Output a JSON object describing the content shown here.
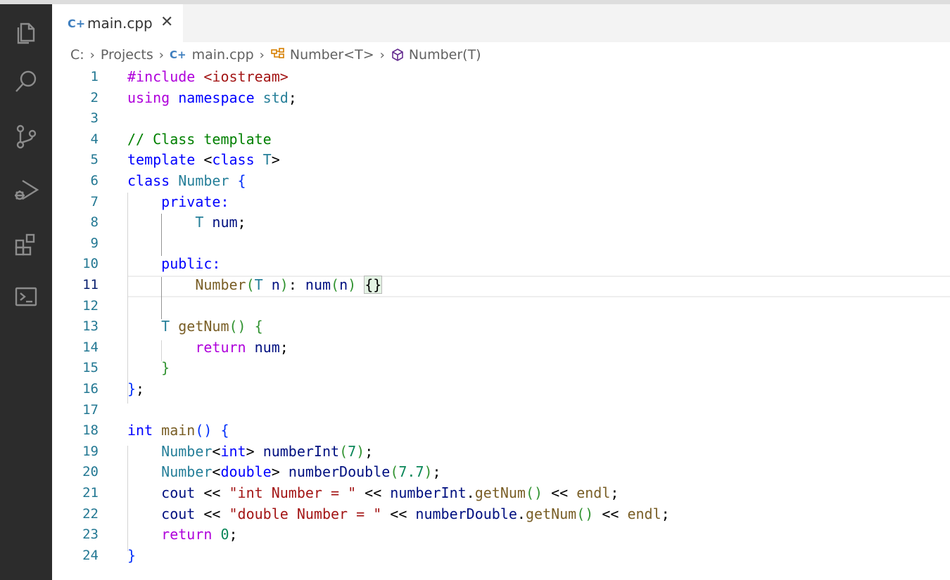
{
  "activity_bar": {
    "icons": [
      "explorer-icon",
      "search-icon",
      "source-control-icon",
      "run-debug-icon",
      "extensions-icon",
      "terminal-icon"
    ]
  },
  "tab": {
    "icon_text": "C+",
    "label": "main.cpp",
    "close": "✕"
  },
  "breadcrumb": {
    "drive": "C:",
    "folder": "Projects",
    "file_icon": "C+",
    "file": "main.cpp",
    "class": "Number<T>",
    "method": "Number(T)",
    "sep": "›"
  },
  "editor": {
    "active_line": 11,
    "line_numbers": [
      "1",
      "2",
      "3",
      "4",
      "5",
      "6",
      "7",
      "8",
      "9",
      "10",
      "11",
      "12",
      "13",
      "14",
      "15",
      "16",
      "17",
      "18",
      "19",
      "20",
      "21",
      "22",
      "23",
      "24"
    ],
    "lines": [
      [
        [
          "ctl",
          "#include "
        ],
        [
          "str",
          "<iostream>"
        ]
      ],
      [
        [
          "ctl",
          "using "
        ],
        [
          "kw",
          "namespace "
        ],
        [
          "ty",
          "std"
        ],
        [
          "",
          "; "
        ]
      ],
      [],
      [
        [
          "cm",
          "// Class template"
        ]
      ],
      [
        [
          "kw",
          "template "
        ],
        [
          "",
          "<"
        ],
        [
          "kw",
          "class "
        ],
        [
          "ty",
          "T"
        ],
        [
          "",
          ">"
        ]
      ],
      [
        [
          "kw",
          "class "
        ],
        [
          "ty",
          "Number "
        ],
        [
          "br",
          "{"
        ]
      ],
      [
        [
          "",
          "    "
        ],
        [
          "kw",
          "private:"
        ]
      ],
      [
        [
          "",
          "        "
        ],
        [
          "ty",
          "T "
        ],
        [
          "var",
          "num"
        ],
        [
          "",
          ";"
        ]
      ],
      [],
      [
        [
          "",
          "    "
        ],
        [
          "kw",
          "public:"
        ]
      ],
      [
        [
          "",
          "        "
        ],
        [
          "fn",
          "Number"
        ],
        [
          "br2",
          "("
        ],
        [
          "ty",
          "T "
        ],
        [
          "var",
          "n"
        ],
        [
          "br2",
          ")"
        ],
        [
          "",
          ": "
        ],
        [
          "var",
          "num"
        ],
        [
          "br2",
          "("
        ],
        [
          "var",
          "n"
        ],
        [
          "br2",
          ") "
        ],
        [
          "bm",
          "{}"
        ]
      ],
      [],
      [
        [
          "",
          "    "
        ],
        [
          "ty",
          "T "
        ],
        [
          "fn",
          "getNum"
        ],
        [
          "br2",
          "() "
        ],
        [
          "br2",
          "{"
        ]
      ],
      [
        [
          "",
          "        "
        ],
        [
          "ctl",
          "return "
        ],
        [
          "var",
          "num"
        ],
        [
          "",
          ";"
        ]
      ],
      [
        [
          "",
          "    "
        ],
        [
          "br2",
          "}"
        ]
      ],
      [
        [
          "br",
          "}"
        ],
        [
          "",
          ";"
        ]
      ],
      [],
      [
        [
          "kw",
          "int "
        ],
        [
          "fn",
          "main"
        ],
        [
          "br",
          "() "
        ],
        [
          "br",
          "{"
        ]
      ],
      [
        [
          "",
          "    "
        ],
        [
          "ty",
          "Number"
        ],
        [
          "",
          "<"
        ],
        [
          "kw",
          "int"
        ],
        [
          "",
          "> "
        ],
        [
          "var",
          "numberInt"
        ],
        [
          "br2",
          "("
        ],
        [
          "num",
          "7"
        ],
        [
          "br2",
          ")"
        ],
        [
          "",
          ";"
        ]
      ],
      [
        [
          "",
          "    "
        ],
        [
          "ty",
          "Number"
        ],
        [
          "",
          "<"
        ],
        [
          "kw",
          "double"
        ],
        [
          "",
          "> "
        ],
        [
          "var",
          "numberDouble"
        ],
        [
          "br2",
          "("
        ],
        [
          "num",
          "7.7"
        ],
        [
          "br2",
          ")"
        ],
        [
          "",
          ";"
        ]
      ],
      [
        [
          "",
          "    "
        ],
        [
          "var",
          "cout "
        ],
        [
          "",
          "<< "
        ],
        [
          "str",
          "\"int Number = \" "
        ],
        [
          "",
          "<< "
        ],
        [
          "var",
          "numberInt"
        ],
        [
          "",
          "."
        ],
        [
          "fn",
          "getNum"
        ],
        [
          "br2",
          "() "
        ],
        [
          "",
          "<< "
        ],
        [
          "fn",
          "endl"
        ],
        [
          "",
          ";"
        ]
      ],
      [
        [
          "",
          "    "
        ],
        [
          "var",
          "cout "
        ],
        [
          "",
          "<< "
        ],
        [
          "str",
          "\"double Number = \" "
        ],
        [
          "",
          "<< "
        ],
        [
          "var",
          "numberDouble"
        ],
        [
          "",
          "."
        ],
        [
          "fn",
          "getNum"
        ],
        [
          "br2",
          "() "
        ],
        [
          "",
          "<< "
        ],
        [
          "fn",
          "endl"
        ],
        [
          "",
          ";"
        ]
      ],
      [
        [
          "",
          "    "
        ],
        [
          "ctl",
          "return "
        ],
        [
          "num",
          "0"
        ],
        [
          "",
          ";"
        ]
      ],
      [
        [
          "br",
          "}"
        ]
      ]
    ]
  }
}
